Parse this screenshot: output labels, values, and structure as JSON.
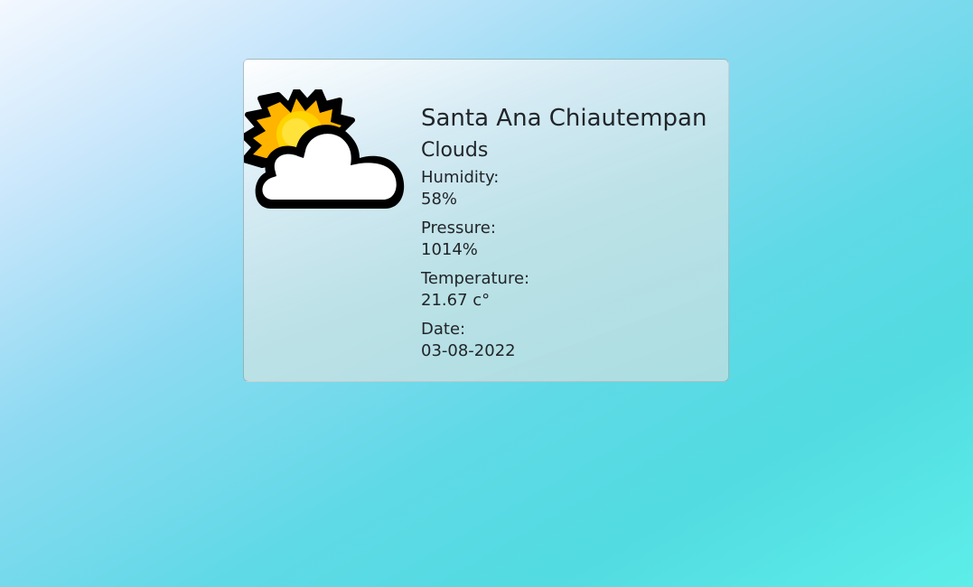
{
  "weather": {
    "city": "Santa Ana Chiautempan",
    "condition": "Clouds",
    "icon": "partly-cloudy-icon",
    "stats": [
      {
        "label": "Humidity:",
        "value": "58%"
      },
      {
        "label": "Pressure:",
        "value": "1014%"
      },
      {
        "label": "Temperature:",
        "value": "21.67 c°"
      },
      {
        "label": "Date:",
        "value": "03-08-2022"
      }
    ]
  }
}
